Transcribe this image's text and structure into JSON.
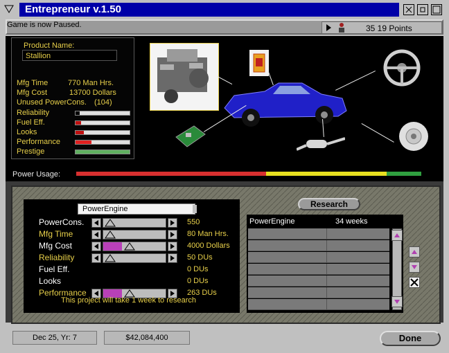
{
  "window": {
    "title": "Entrepreneur v.1.50"
  },
  "status": {
    "message": "Game is now Paused.",
    "points": "35 19 Points"
  },
  "product": {
    "name_label": "Product Name:",
    "name_value": "Stallion",
    "mfg_time_label": "Mfg Time",
    "mfg_time_value": "770 Man Hrs.",
    "mfg_cost_label": "Mfg Cost",
    "mfg_cost_value": "13700 Dollars",
    "unused_power_label": "Unused PowerCons.",
    "unused_power_value": "(104)",
    "attributes": [
      {
        "label": "Reliability",
        "level": 0.08,
        "color": "#000000"
      },
      {
        "label": "Fuel Eff.",
        "level": 0.1,
        "color": "#c01010"
      },
      {
        "label": "Looks",
        "level": 0.16,
        "color": "#c01010"
      },
      {
        "label": "Performance",
        "level": 0.3,
        "color": "#e02020"
      },
      {
        "label": "Prestige",
        "level": 1.0,
        "color": "#60b060"
      }
    ]
  },
  "power_usage": {
    "label": "Power Usage:",
    "segments": [
      {
        "fraction": 0.55,
        "color": "#d83030"
      },
      {
        "fraction": 0.35,
        "color": "#e8e020"
      },
      {
        "fraction": 0.1,
        "color": "#30a040"
      }
    ]
  },
  "research": {
    "component_name": "PowerEngine",
    "button_label": "Research",
    "rows": [
      {
        "label": "PowerCons.",
        "value": "550",
        "level": 0.0,
        "label_color": "white"
      },
      {
        "label": "Mfg Time",
        "value": "80 Man Hrs.",
        "level": 0.0,
        "label_color": "yellow"
      },
      {
        "label": "Mfg Cost",
        "value": "4000 Dollars",
        "level": 0.3,
        "label_color": "white"
      },
      {
        "label": "Reliability",
        "value": "50 DUs",
        "level": 0.0,
        "label_color": "yellow"
      },
      {
        "label": "Fuel Eff.",
        "value": "0 DUs",
        "level": null,
        "label_color": "white"
      },
      {
        "label": "Looks",
        "value": "0 DUs",
        "level": null,
        "label_color": "white"
      },
      {
        "label": "Performance",
        "value": "263 DUs",
        "level": 0.3,
        "label_color": "yellow"
      }
    ],
    "footer": "This project will take 1 week to research",
    "queue": [
      {
        "name": "PowerEngine",
        "duration": "34 weeks"
      }
    ]
  },
  "bottom": {
    "date": "Dec 25, Yr: 7",
    "money": "$42,084,400",
    "done_label": "Done"
  },
  "icons": {
    "close": "close-icon",
    "minimize": "minimize-icon",
    "maximize": "maximize-icon"
  }
}
